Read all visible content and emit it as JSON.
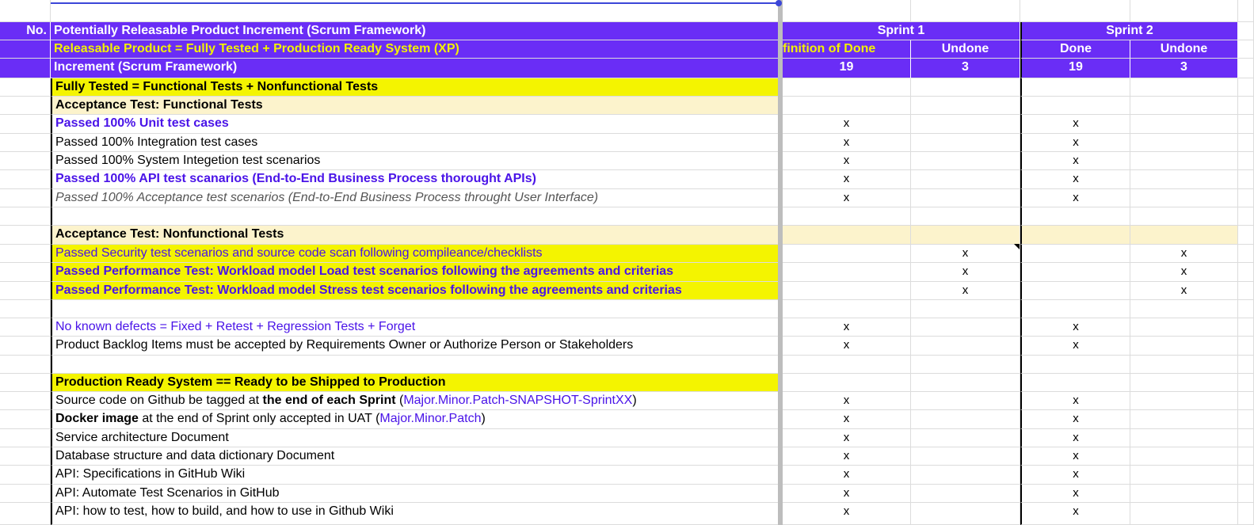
{
  "header": {
    "no_label": "No.",
    "row1_title": "Potentially Releasable Product Increment (Scrum Framework)",
    "row2_title": "Releasable Product = Fully Tested + Production Ready System (XP)",
    "row3_title": "Increment (Scrum Framework)",
    "sprint1": "Sprint 1",
    "sprint2": "Sprint 2",
    "s1_col_a": "finition of Done",
    "s1_col_b": "Undone",
    "s2_col_a": "Done",
    "s2_col_b": "Undone",
    "s1_done_count": "19",
    "s1_undone_count": "3",
    "s2_done_count": "19",
    "s2_undone_count": "3"
  },
  "rows": [
    {
      "text": "Fully Tested = Functional Tests + Nonfunctional Tests",
      "s1d": "",
      "s1u": "",
      "s2d": "",
      "s2u": ""
    },
    {
      "text": "Acceptance Test: Functional Tests",
      "s1d": "",
      "s1u": "",
      "s2d": "",
      "s2u": ""
    },
    {
      "text": "Passed 100% Unit test cases",
      "s1d": "x",
      "s1u": "",
      "s2d": "x",
      "s2u": ""
    },
    {
      "text": "Passed 100% Integration test cases",
      "s1d": "x",
      "s1u": "",
      "s2d": "x",
      "s2u": ""
    },
    {
      "text": "Passed 100% System Integetion test scenarios",
      "s1d": "x",
      "s1u": "",
      "s2d": "x",
      "s2u": ""
    },
    {
      "text": "Passed 100% API test scanarios (End-to-End Business Process thorought APIs)",
      "s1d": "x",
      "s1u": "",
      "s2d": "x",
      "s2u": ""
    },
    {
      "text": "Passed 100% Acceptance test scenarios (End-to-End Business Process throught User Interface)",
      "s1d": "x",
      "s1u": "",
      "s2d": "x",
      "s2u": ""
    },
    {
      "text": "",
      "s1d": "",
      "s1u": "",
      "s2d": "",
      "s2u": ""
    },
    {
      "text": "Acceptance Test: Nonfunctional Tests",
      "s1d": "",
      "s1u": "",
      "s2d": "",
      "s2u": ""
    },
    {
      "text": "Passed Security test scenarios and source code scan following compileance/checklists",
      "s1d": "",
      "s1u": "x",
      "s2d": "",
      "s2u": "x"
    },
    {
      "text": "Passed Performance Test: Workload model Load test scenarios following the agreements and criterias",
      "s1d": "",
      "s1u": "x",
      "s2d": "",
      "s2u": "x"
    },
    {
      "text": "Passed Performance Test: Workload model Stress test scenarios following the agreements and criterias",
      "s1d": "",
      "s1u": "x",
      "s2d": "",
      "s2u": "x"
    },
    {
      "text": "",
      "s1d": "",
      "s1u": "",
      "s2d": "",
      "s2u": ""
    },
    {
      "text": "No known defects = Fixed + Retest + Regression Tests + Forget",
      "s1d": "x",
      "s1u": "",
      "s2d": "x",
      "s2u": ""
    },
    {
      "text": "Product Backlog Items must be accepted by Requirements Owner or Authorize Person or Stakeholders",
      "s1d": "x",
      "s1u": "",
      "s2d": "x",
      "s2u": ""
    },
    {
      "text": "",
      "s1d": "",
      "s1u": "",
      "s2d": "",
      "s2u": ""
    },
    {
      "text": "Production Ready System == Ready to be Shipped to Production",
      "s1d": "",
      "s1u": "",
      "s2d": "",
      "s2u": ""
    },
    {
      "text_a": "Source code on Github be tagged at ",
      "text_b": "the end of each Sprint",
      "text_c": " (",
      "text_d": "Major.Minor.Patch-SNAPSHOT-SprintXX",
      "text_e": ")",
      "s1d": "x",
      "s1u": "",
      "s2d": "x",
      "s2u": ""
    },
    {
      "text_a": "Docker image",
      "text_b": " at the end of Sprint only accepted in UAT (",
      "text_c": "Major.Minor.Patch",
      "text_d": ")",
      "s1d": "x",
      "s1u": "",
      "s2d": "x",
      "s2u": ""
    },
    {
      "text": "Service architecture Document",
      "s1d": "x",
      "s1u": "",
      "s2d": "x",
      "s2u": ""
    },
    {
      "text": "Database structure and data dictionary Document",
      "s1d": "x",
      "s1u": "",
      "s2d": "x",
      "s2u": ""
    },
    {
      "text": "API: Specifications in GitHub Wiki",
      "s1d": "x",
      "s1u": "",
      "s2d": "x",
      "s2u": ""
    },
    {
      "text": "API: Automate Test Scenarios in GitHub",
      "s1d": "x",
      "s1u": "",
      "s2d": "x",
      "s2u": ""
    },
    {
      "text": "API: how to test, how to build, and how to use in Github Wiki",
      "s1d": "x",
      "s1u": "",
      "s2d": "x",
      "s2u": ""
    }
  ],
  "colors": {
    "header_bg": "#6a2df6",
    "highlight_yellow": "#f4f400",
    "section_cream": "#fcf3cc",
    "accent_purple_text": "#4a14e8"
  }
}
